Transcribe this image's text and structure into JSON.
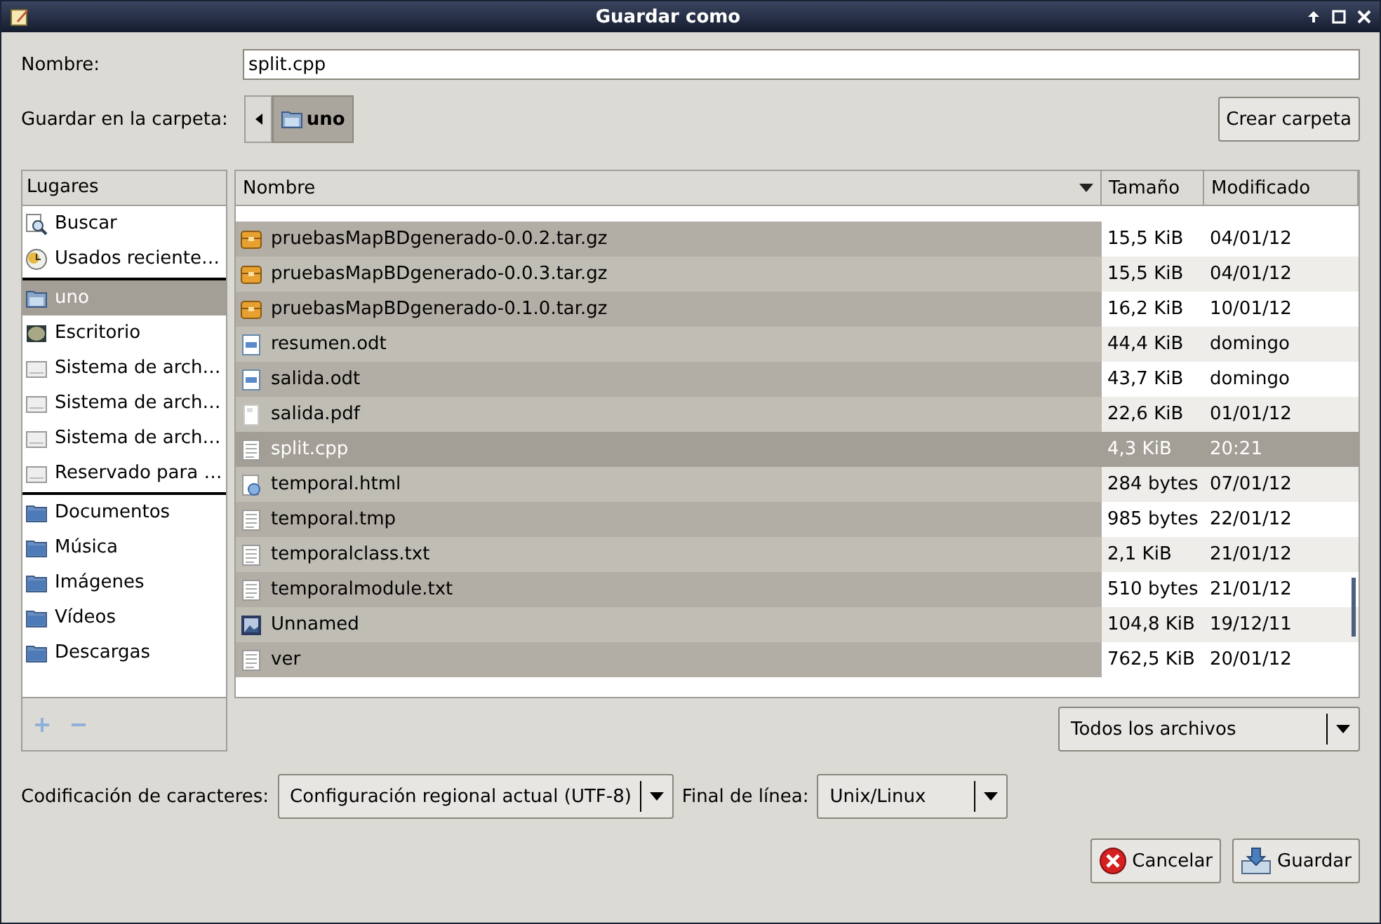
{
  "window": {
    "title": "Guardar como"
  },
  "name_field": {
    "label": "Nombre:",
    "value": "split.cpp"
  },
  "folder": {
    "label": "Guardar en la carpeta:",
    "current": "uno",
    "create_button": "Crear carpeta"
  },
  "sidebar": {
    "header": "Lugares",
    "groups": [
      [
        {
          "label": "Buscar",
          "kind": "search",
          "selected": false
        },
        {
          "label": "Usados reciente…",
          "kind": "recent",
          "selected": false
        }
      ],
      [
        {
          "label": "uno",
          "kind": "home",
          "selected": true
        },
        {
          "label": "Escritorio",
          "kind": "desktop",
          "selected": false
        },
        {
          "label": "Sistema de arch…",
          "kind": "drive",
          "selected": false
        },
        {
          "label": "Sistema de arch…",
          "kind": "drive",
          "selected": false
        },
        {
          "label": "Sistema de arch…",
          "kind": "drive",
          "selected": false
        },
        {
          "label": "Reservado para …",
          "kind": "drive",
          "selected": false
        }
      ],
      [
        {
          "label": "Documentos",
          "kind": "folder",
          "selected": false
        },
        {
          "label": "Música",
          "kind": "folder",
          "selected": false
        },
        {
          "label": "Imágenes",
          "kind": "folder",
          "selected": false
        },
        {
          "label": "Vídeos",
          "kind": "folder",
          "selected": false
        },
        {
          "label": "Descargas",
          "kind": "folder",
          "selected": false
        }
      ]
    ]
  },
  "table": {
    "columns": [
      "Nombre",
      "Tamaño",
      "Modificado"
    ],
    "rows": [
      {
        "name": "pruebasMapBDgenerado-0.0.2.tar.gz",
        "size": "15,5 KiB",
        "modified": "04/01/12",
        "kind": "archive",
        "selected": false
      },
      {
        "name": "pruebasMapBDgenerado-0.0.3.tar.gz",
        "size": "15,5 KiB",
        "modified": "04/01/12",
        "kind": "archive",
        "selected": false
      },
      {
        "name": "pruebasMapBDgenerado-0.1.0.tar.gz",
        "size": "16,2 KiB",
        "modified": "10/01/12",
        "kind": "archive",
        "selected": false
      },
      {
        "name": "resumen.odt",
        "size": "44,4 KiB",
        "modified": "domingo",
        "kind": "document",
        "selected": false
      },
      {
        "name": "salida.odt",
        "size": "43,7 KiB",
        "modified": "domingo",
        "kind": "document",
        "selected": false
      },
      {
        "name": "salida.pdf",
        "size": "22,6 KiB",
        "modified": "01/01/12",
        "kind": "pdf",
        "selected": false
      },
      {
        "name": "split.cpp",
        "size": "4,3 KiB",
        "modified": "20:21",
        "kind": "text",
        "selected": true
      },
      {
        "name": "temporal.html",
        "size": "284 bytes",
        "modified": "07/01/12",
        "kind": "html",
        "selected": false
      },
      {
        "name": "temporal.tmp",
        "size": "985 bytes",
        "modified": "22/01/12",
        "kind": "text",
        "selected": false
      },
      {
        "name": "temporalclass.txt",
        "size": "2,1 KiB",
        "modified": "21/01/12",
        "kind": "text",
        "selected": false
      },
      {
        "name": "temporalmodule.txt",
        "size": "510 bytes",
        "modified": "21/01/12",
        "kind": "text",
        "selected": false
      },
      {
        "name": "Unnamed",
        "size": "104,8 KiB",
        "modified": "19/12/11",
        "kind": "image",
        "selected": false
      },
      {
        "name": "ver",
        "size": "762,5 KiB",
        "modified": "20/01/12",
        "kind": "text",
        "selected": false
      }
    ]
  },
  "filter": {
    "value": "Todos los archivos"
  },
  "encoding": {
    "label": "Codificación de caracteres:",
    "value": "Configuración regional actual (UTF-8)"
  },
  "line_ending": {
    "label": "Final de línea:",
    "value": "Unix/Linux"
  },
  "buttons": [
    {
      "label": "Cancelar",
      "kind": "cancel"
    },
    {
      "label": "Guardar",
      "kind": "save"
    }
  ]
}
